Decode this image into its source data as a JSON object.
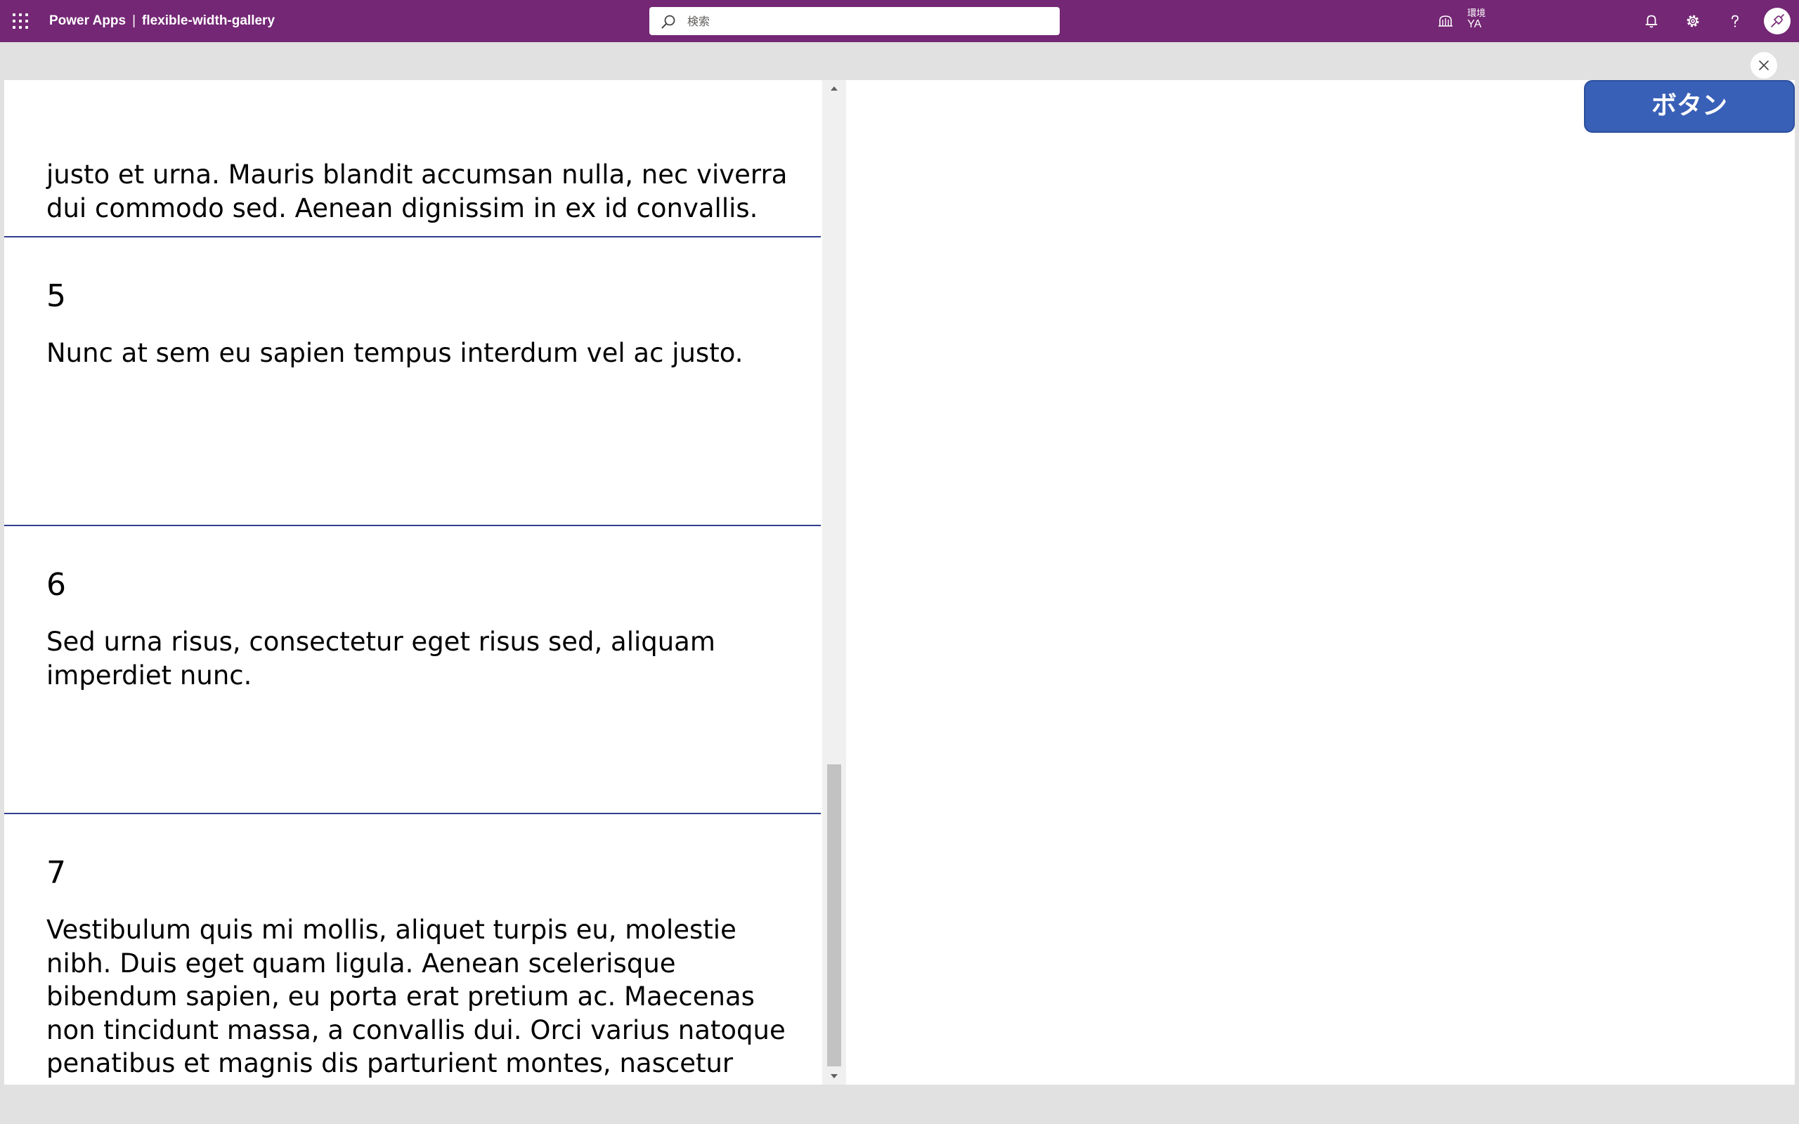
{
  "header": {
    "app_name": "Power Apps",
    "separator": "|",
    "app_title": "flexible-width-gallery",
    "search_placeholder": "検索",
    "environment_label": "環境",
    "environment_name": "YA"
  },
  "gallery": {
    "items": [
      {
        "number": "",
        "text": "justo et urna. Mauris blandit accumsan nulla, nec viverra dui commodo sed. Aenean dignissim in ex id convallis."
      },
      {
        "number": "5",
        "text": "Nunc at sem eu sapien tempus interdum vel ac justo."
      },
      {
        "number": "6",
        "text": "Sed urna risus, consectetur eget risus sed, aliquam imperdiet nunc."
      },
      {
        "number": "7",
        "text": "Vestibulum quis mi mollis, aliquet turpis eu, molestie nibh. Duis eget quam ligula. Aenean scelerisque bibendum sapien, eu porta erat pretium ac. Maecenas non tincidunt massa, a convallis dui. Orci varius natoque penatibus et magnis dis parturient montes, nascetur ridiculus mus. Aliquam commodo non sem sed fermentum."
      }
    ]
  },
  "button": {
    "label": "ボタン"
  },
  "icons": {
    "waffle": "app-launcher-icon",
    "search": "search-icon",
    "environment": "environment-icon",
    "notifications": "bell-icon",
    "settings": "gear-icon",
    "help": "question-icon",
    "avatar": "user-avatar-icon",
    "close": "close-icon",
    "scroll_up": "chevron-up-icon",
    "scroll_down": "chevron-down-icon"
  },
  "colors": {
    "header": "#742774",
    "button": "#3960b7",
    "divider": "#2f3e8f",
    "workspace": "#e1e1e1"
  }
}
